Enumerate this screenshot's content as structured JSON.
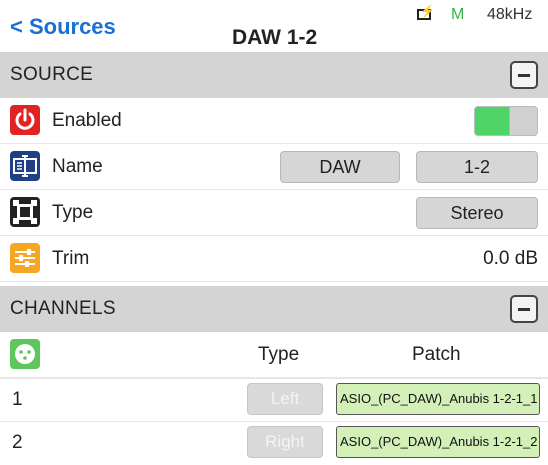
{
  "header": {
    "back_label": "< Sources",
    "title": "DAW 1-2",
    "status_mode": "M",
    "sample_rate": "48kHz",
    "status_icon": "battery-charging-icon"
  },
  "source_section": {
    "label": "SOURCE",
    "enabled": {
      "label": "Enabled",
      "icon": "power-icon",
      "toggle_on": true,
      "accent_color": "#4fd468"
    },
    "name": {
      "label": "Name",
      "icon": "name-tag-icon",
      "value_left": "DAW",
      "value_right": "1-2"
    },
    "type": {
      "label": "Type",
      "icon": "stereo-frame-icon",
      "value": "Stereo"
    },
    "trim": {
      "label": "Trim",
      "icon": "sliders-icon",
      "value": "0.0 dB"
    }
  },
  "channels_section": {
    "label": "CHANNELS",
    "header_icon": "xlr-connector-icon",
    "col_type": "Type",
    "col_patch": "Patch",
    "rows": [
      {
        "num": "1",
        "type": "Left",
        "patch": "ASIO_(PC_DAW)_Anubis 1-2-1_1"
      },
      {
        "num": "2",
        "type": "Right",
        "patch": "ASIO_(PC_DAW)_Anubis 1-2-1_2"
      }
    ]
  },
  "colors": {
    "link": "#1a6fd6",
    "section_bg": "#d4d4d4",
    "patch_bg": "#d3f0b9",
    "status_green": "#37b34a"
  }
}
